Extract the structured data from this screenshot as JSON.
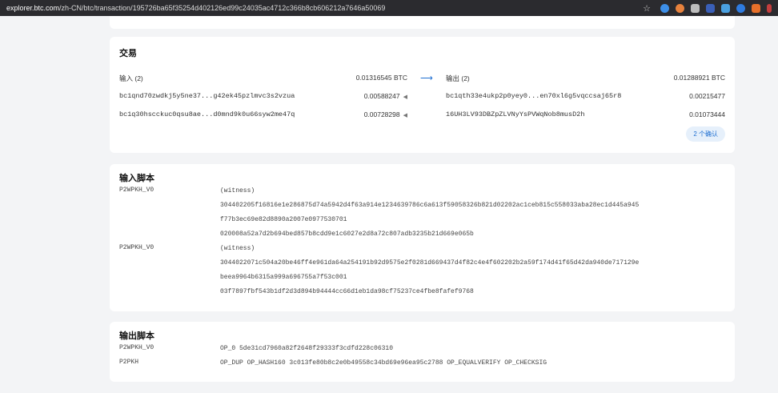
{
  "browser": {
    "url_host": "explorer.btc.com",
    "url_path": "/zh-CN/btc/transaction/195726ba65f35254d402126ed99c24035ac4712c366b8cb606212a7646a50069",
    "star": "☆"
  },
  "transaction": {
    "title": "交易",
    "inputs_label": "输入 (2)",
    "inputs_total": "0.01316545 BTC",
    "arrow": "⟶",
    "outputs_label": "输出 (2)",
    "outputs_total": "0.01288921 BTC",
    "inputs": [
      {
        "address": "bc1qnd70zwdkj5y5ne37...g42ek45pzlmvc3s2vzua",
        "amount": "0.00588247"
      },
      {
        "address": "bc1q30hscckuc0qsu8ae...d0mnd9k0u66syw2me47q",
        "amount": "0.00728298"
      }
    ],
    "outputs": [
      {
        "address": "bc1qth33e4ukp2p0yey0...en70xl6g5vqccsaj65r8",
        "amount": "0.00215477"
      },
      {
        "address": "16UH3LV93DBZpZLVNyYsPVWqNob8musD2h",
        "amount": "0.01073444"
      }
    ],
    "confirmations": "2 个确认"
  },
  "input_scripts": {
    "title": "输入脚本",
    "items": [
      {
        "type": "P2WPKH_V0",
        "lines": [
          "(witness)",
          "304402205f16816e1e286875d74a5942d4f63a914e1234639786c6a613f59058326b821d02202ac1ceb815c558033aba28ec1d445a945",
          "f77b3ec69e82d8890a2007e0977530701",
          "020008a52a7d2b694bed857b8cdd9e1c6027e2d8a72c807adb3235b21d669e065b"
        ]
      },
      {
        "type": "P2WPKH_V0",
        "lines": [
          "(witness)",
          "3044022071c504a20be46ff4e961da64a254191b92d9575e2f0281d669437d4f82c4e4f602202b2a59f174d41f65d42da940de717129e",
          "beea9964b6315a999a696755a7f53c001",
          "03f7897fbf543b1df2d3d894b94444cc66d1eb1da98cf75237ce4fbe8fafef9768"
        ]
      }
    ]
  },
  "output_scripts": {
    "title": "输出脚本",
    "items": [
      {
        "type": "P2WPKH_V0",
        "script": "OP_0 5de31cd7960a82f2648f29333f3cdfd228c06310"
      },
      {
        "type": "P2PKH",
        "script": "OP_DUP OP_HASH160 3c013fe80b8c2e0b49558c34bd69e96ea95c2788 OP_EQUALVERIFY OP_CHECKSIG"
      }
    ]
  }
}
